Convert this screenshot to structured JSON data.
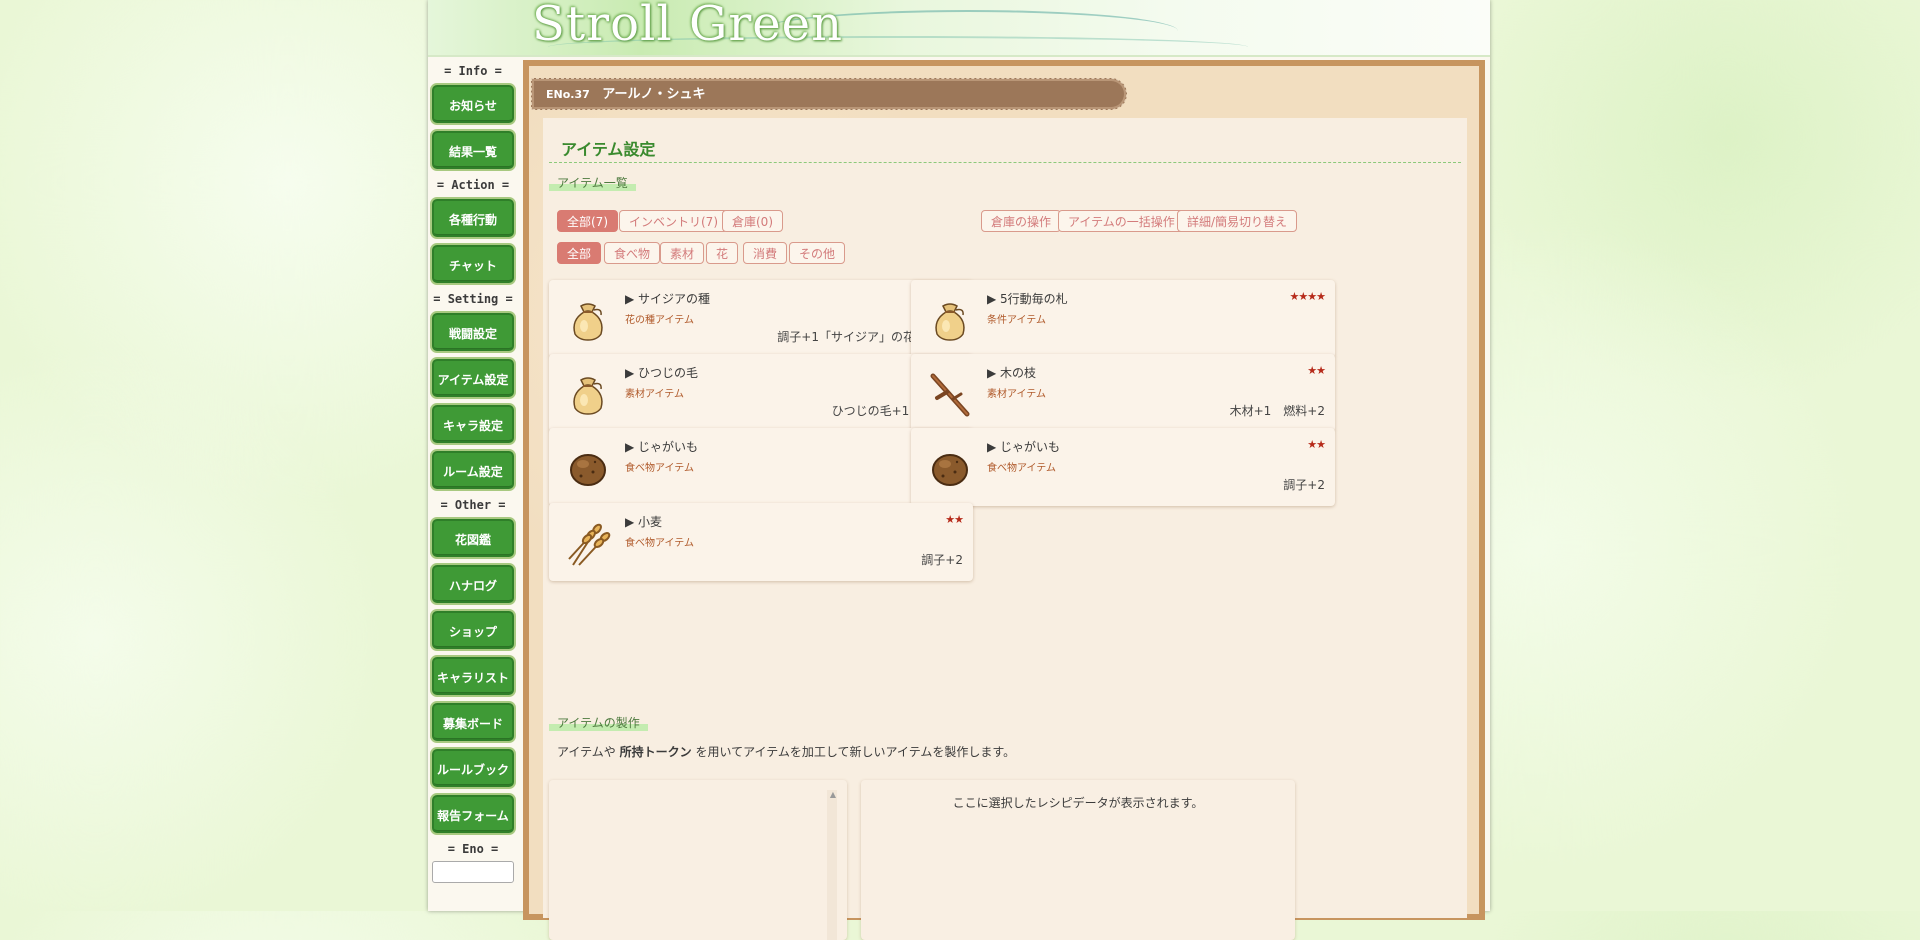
{
  "banner": {
    "title": "Stroll Green"
  },
  "sidebar": {
    "groups": [
      {
        "heading": "= Info =",
        "items": [
          "お知らせ",
          "結果一覧"
        ]
      },
      {
        "heading": "= Action =",
        "items": [
          "各種行動",
          "チャット"
        ]
      },
      {
        "heading": "= Setting =",
        "items": [
          "戦闘設定",
          "アイテム設定",
          "キャラ設定",
          "ルーム設定"
        ]
      },
      {
        "heading": "= Other =",
        "items": [
          "花図鑑",
          "ハナログ",
          "ショップ",
          "キャラリスト",
          "募集ボード",
          "ルールブック",
          "報告フォーム"
        ]
      },
      {
        "heading": "= Eno =",
        "items": []
      }
    ]
  },
  "character": {
    "eno": "ENo.37",
    "name": "アールノ・シュキ"
  },
  "section": {
    "title": "アイテム設定",
    "list_subtitle": "アイテム一覧",
    "craft_subtitle": "アイテムの製作"
  },
  "filters": {
    "location": [
      "全部(7)",
      "インベントリ(7)",
      "倉庫(0)"
    ],
    "actions": [
      "倉庫の操作",
      "アイテムの一括操作",
      "詳細/簡易切り替え"
    ],
    "category": [
      "全部",
      "食べ物",
      "素材",
      "花",
      "消費",
      "その他"
    ]
  },
  "items": [
    {
      "name": "▶ サイジアの種",
      "type": "花の種アイテム",
      "stars": "★★★★★",
      "effect": "調子+1「サイジア」の花壇の開放",
      "icon": "bag-icon"
    },
    {
      "name": "▶ 5行動毎の札",
      "type": "条件アイテム",
      "stars": "★★★★",
      "effect": "",
      "icon": "bag-icon"
    },
    {
      "name": "▶ ひつじの毛",
      "type": "素材アイテム",
      "stars": "★★★",
      "effect": "ひつじの毛+1　繊維+1",
      "icon": "bag-icon"
    },
    {
      "name": "▶ 木の枝",
      "type": "素材アイテム",
      "stars": "★★",
      "effect": "木材+1　燃料+2",
      "icon": "branch-icon"
    },
    {
      "name": "▶ じゃがいも",
      "type": "食べ物アイテム",
      "stars": "★★",
      "effect": "調子+2",
      "icon": "potato-icon"
    },
    {
      "name": "▶ じゃがいも",
      "type": "食べ物アイテム",
      "stars": "★★",
      "effect": "調子+2",
      "icon": "potato-icon"
    },
    {
      "name": "▶ 小麦",
      "type": "食べ物アイテム",
      "stars": "★★",
      "effect": "調子+2",
      "icon": "wheat-icon"
    }
  ],
  "craft": {
    "desc_pre": "アイテムや ",
    "desc_bold": "所持トークン",
    "desc_post": " を用いてアイテムを加工して新しいアイテムを製作します。",
    "recipe_placeholder": "ここに選択したレシピデータが表示されます。"
  }
}
